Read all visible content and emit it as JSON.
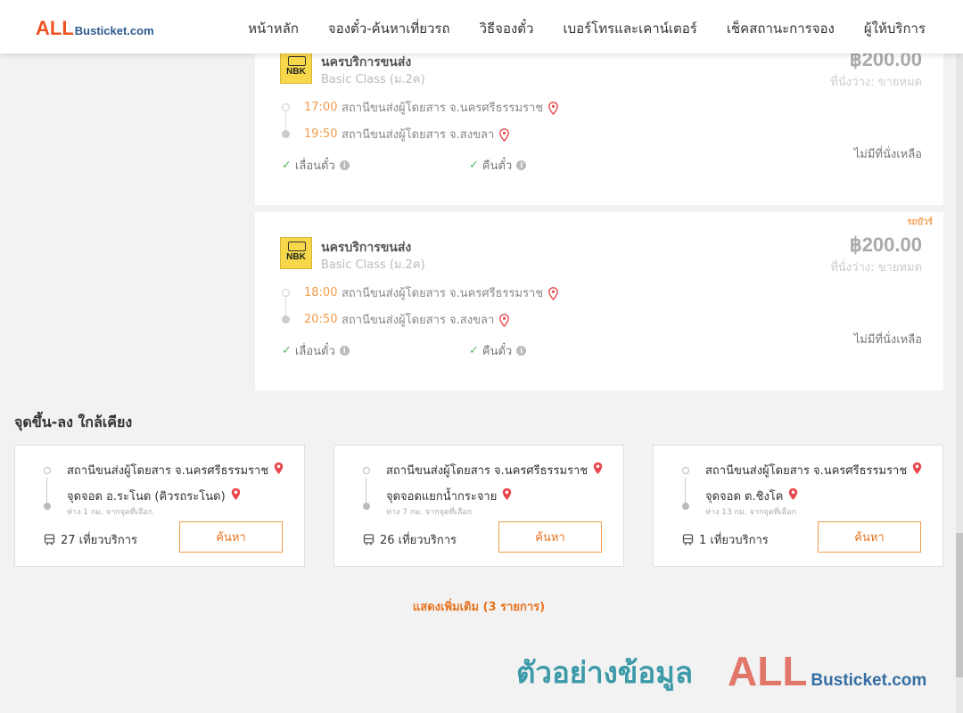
{
  "header": {
    "logo_all": "ALL",
    "logo_rest": "Busticket.com",
    "nav": [
      "หน้าหลัก",
      "จองตั๋ว-ค้นหาเที่ยวรถ",
      "วิธีจองตั๋ว",
      "เบอร์โทรและเคาน์เตอร์",
      "เช็คสถานะการจอง",
      "ผู้ให้บริการ"
    ]
  },
  "trips": [
    {
      "operator": "นครบริการขนส่ง",
      "class": "Basic Class (ม.2ค)",
      "price": "฿200.00",
      "seats_status": "ที่นั่งว่าง: ขายหมด",
      "tag": "",
      "depart_time": "17:00",
      "depart_station": "สถานีขนส่งผู้โดยสาร จ.นครศรีธรรมราช",
      "arrive_time": "19:50",
      "arrive_station": "สถานีขนส่งผู้โดยสาร จ.สงขลา",
      "feature_1": "เลื่อนตั๋ว",
      "feature_2": "คืนตั๋ว",
      "no_seat": "ไม่มีที่นั่งเหลือ"
    },
    {
      "operator": "นครบริการขนส่ง",
      "class": "Basic Class (ม.2ค)",
      "price": "฿200.00",
      "seats_status": "ที่นั่งว่าง: ขายหมด",
      "tag": "รถบัวร์",
      "depart_time": "18:00",
      "depart_station": "สถานีขนส่งผู้โดยสาร จ.นครศรีธรรมราช",
      "arrive_time": "20:50",
      "arrive_station": "สถานีขนส่งผู้โดยสาร จ.สงขลา",
      "feature_1": "เลื่อนตั๋ว",
      "feature_2": "คืนตั๋ว",
      "no_seat": "ไม่มีที่นั่งเหลือ"
    }
  ],
  "operator_logo_text": "NBK",
  "nearby": {
    "title": "จุดขึ้น-ลง ใกล้เคียง",
    "cards": [
      {
        "from": "สถานีขนส่งผู้โดยสาร จ.นครศรีธรรมราช",
        "to": "จุดจอด อ.ระโนด (คิวรถระโนด)",
        "distance": "ห่าง 1 กม. จากจุดที่เลือก",
        "trips": "27 เที่ยวบริการ",
        "button": "ค้นหา"
      },
      {
        "from": "สถานีขนส่งผู้โดยสาร จ.นครศรีธรรมราช",
        "to": "จุดจอดแยกน้ำกระจาย",
        "distance": "ห่าง 7 กม. จากจุดที่เลือก",
        "trips": "26 เที่ยวบริการ",
        "button": "ค้นหา"
      },
      {
        "from": "สถานีขนส่งผู้โดยสาร จ.นครศรีธรรมราช",
        "to": "จุดจอด ต.ชิงโค",
        "distance": "ห่าง 13 กม. จากจุดที่เลือก",
        "trips": "1 เที่ยวบริการ",
        "button": "ค้นหา"
      }
    ],
    "show_more": "แสดงเพิ่มเติม (3 รายการ)"
  },
  "watermark": {
    "text": "ตัวอย่างข้อมูล",
    "logo_all": "ALL",
    "logo_rest": "Busticket.com"
  },
  "footer_partial": "... ... ...",
  "colors": {
    "accent": "#f39c4a",
    "brand_orange": "#ef5323",
    "brand_blue": "#2d5a8e",
    "check_green": "#5ab55e",
    "pin_red": "#e8474b"
  }
}
